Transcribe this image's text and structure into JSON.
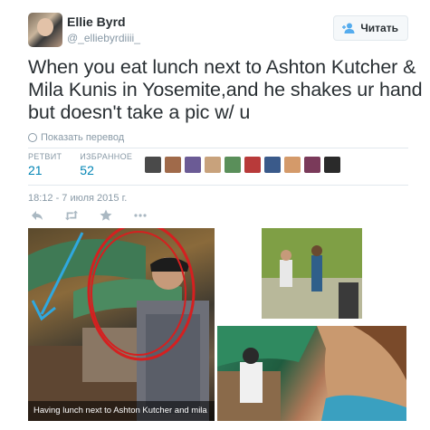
{
  "user": {
    "display_name": "Ellie Byrd",
    "screen_name": "@_elliebyrdiiii_",
    "follow_label": "Читать"
  },
  "tweet": {
    "text": "When you eat lunch next to Ashton Kutcher & Mila Kunis in Yosemite,and he shakes ur hand but doesn't take a pic w/ u",
    "translate_label": "Показать перевод",
    "timestamp": "18:12 - 7 июля 2015 г."
  },
  "stats": {
    "retweets_label": "РЕТВИТ",
    "retweets_value": "21",
    "favorites_label": "ИЗБРАННОЕ",
    "favorites_value": "52"
  },
  "favoriters": [
    {
      "name": "favoriter-avatar-1",
      "color": "#4a4a4a"
    },
    {
      "name": "favoriter-avatar-2",
      "color": "#a06a4a"
    },
    {
      "name": "favoriter-avatar-3",
      "color": "#6b5b95"
    },
    {
      "name": "favoriter-avatar-4",
      "color": "#c8a27c"
    },
    {
      "name": "favoriter-avatar-5",
      "color": "#5a8f5a"
    },
    {
      "name": "favoriter-avatar-6",
      "color": "#b83a3a"
    },
    {
      "name": "favoriter-avatar-7",
      "color": "#3a5a8a"
    },
    {
      "name": "favoriter-avatar-8",
      "color": "#d49a6a"
    },
    {
      "name": "favoriter-avatar-9",
      "color": "#7a3a5a"
    },
    {
      "name": "favoriter-avatar-10",
      "color": "#2a2a2a"
    }
  ],
  "actions": [
    {
      "name": "reply-icon"
    },
    {
      "name": "retweet-icon"
    },
    {
      "name": "favorite-icon"
    },
    {
      "name": "more-icon"
    }
  ],
  "media": {
    "main_caption": "Having lunch next to Ashton Kutcher and mila"
  },
  "colors": {
    "link": "#0084b4",
    "muted": "#8899a6",
    "text": "#292f33",
    "annotation_red": "#d42020",
    "annotation_blue": "#2fa8e0"
  }
}
